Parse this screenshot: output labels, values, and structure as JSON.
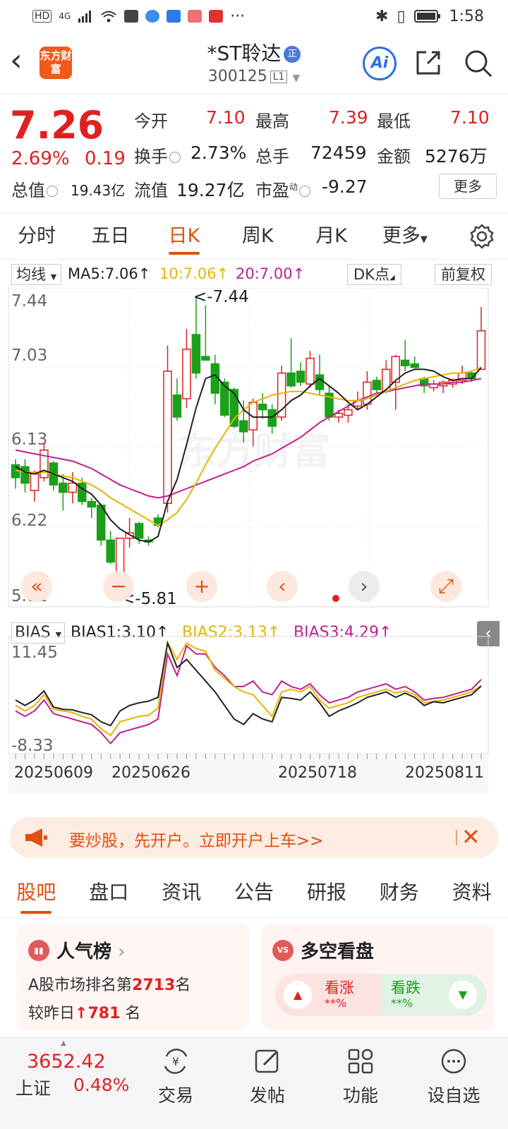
{
  "status_bar": {
    "time": "1:58",
    "network": "4G"
  },
  "header": {
    "stock_name": "*ST聆达",
    "stock_code": "300125",
    "level": "L1",
    "brand_logo_text": "东方财富",
    "ai_label": "Ai"
  },
  "quote": {
    "price": "7.26",
    "change_pct": "2.69%",
    "change": "0.19",
    "fields": [
      {
        "label": "今开",
        "value": "7.10"
      },
      {
        "label": "最高",
        "value": "7.39"
      },
      {
        "label": "最低",
        "value": "7.10"
      },
      {
        "label": "换手",
        "value": "2.73%"
      },
      {
        "label": "总手",
        "value": "72459"
      },
      {
        "label": "金额",
        "value": "5276万"
      },
      {
        "label": "总值",
        "value": "19.43亿"
      },
      {
        "label": "流值",
        "value": "19.27亿"
      },
      {
        "label": "市盈",
        "value": "-9.27"
      }
    ],
    "pe_superscript": "动",
    "more_label": "更多"
  },
  "period_tabs": [
    "分时",
    "五日",
    "日K",
    "周K",
    "月K",
    "更多"
  ],
  "active_period": "日K",
  "ma_bar": {
    "selector": "均线",
    "ma5": "MA5:7.06",
    "ma10": "10:7.06",
    "ma20": "20:7.00",
    "dk_label": "DK点",
    "adjust_label": "前复权"
  },
  "colors": {
    "up": "#e02020",
    "down": "#1aa01a",
    "accent": "#e05010",
    "ma5": "#222222",
    "ma10": "#e8b400",
    "ma20": "#c0208e"
  },
  "chart_data": [
    {
      "type": "candlestick",
      "y_ticks": [
        "7.44",
        "7.03",
        "6.13",
        "6.22",
        "5.81"
      ],
      "ylim": [
        5.81,
        7.44
      ],
      "annotations": [
        "<-7.44",
        "<-5.81"
      ],
      "x_ticks": [
        "20250609",
        "20250626",
        "20250718",
        "20250811"
      ],
      "candles": [
        {
          "o": 6.53,
          "h": 6.56,
          "l": 6.4,
          "c": 6.46
        },
        {
          "o": 6.52,
          "h": 6.56,
          "l": 6.38,
          "c": 6.43
        },
        {
          "o": 6.39,
          "h": 6.5,
          "l": 6.33,
          "c": 6.48
        },
        {
          "o": 6.46,
          "h": 6.65,
          "l": 6.44,
          "c": 6.61
        },
        {
          "o": 6.54,
          "h": 6.55,
          "l": 6.39,
          "c": 6.42
        },
        {
          "o": 6.43,
          "h": 6.48,
          "l": 6.28,
          "c": 6.38
        },
        {
          "o": 6.38,
          "h": 6.49,
          "l": 6.32,
          "c": 6.43
        },
        {
          "o": 6.43,
          "h": 6.46,
          "l": 6.31,
          "c": 6.33
        },
        {
          "o": 6.33,
          "h": 6.35,
          "l": 6.24,
          "c": 6.3
        },
        {
          "o": 6.31,
          "h": 6.32,
          "l": 6.09,
          "c": 6.12
        },
        {
          "o": 6.12,
          "h": 6.17,
          "l": 5.99,
          "c": 6.0
        },
        {
          "o": 5.88,
          "h": 6.13,
          "l": 5.81,
          "c": 6.13
        },
        {
          "o": 6.13,
          "h": 6.24,
          "l": 6.08,
          "c": 6.16
        },
        {
          "o": 6.21,
          "h": 6.22,
          "l": 6.1,
          "c": 6.13
        },
        {
          "o": 6.12,
          "h": 6.14,
          "l": 6.09,
          "c": 6.11
        },
        {
          "o": 6.24,
          "h": 6.26,
          "l": 6.19,
          "c": 6.2
        },
        {
          "o": 6.32,
          "h": 7.18,
          "l": 6.27,
          "c": 7.04
        },
        {
          "o": 6.91,
          "h": 7.0,
          "l": 6.77,
          "c": 6.79
        },
        {
          "o": 6.89,
          "h": 7.27,
          "l": 6.84,
          "c": 7.16
        },
        {
          "o": 7.24,
          "h": 7.44,
          "l": 7.0,
          "c": 7.03
        },
        {
          "o": 7.12,
          "h": 7.4,
          "l": 7.1,
          "c": 7.1
        },
        {
          "o": 7.08,
          "h": 7.13,
          "l": 6.86,
          "c": 6.92
        },
        {
          "o": 6.98,
          "h": 7.0,
          "l": 6.79,
          "c": 6.8
        },
        {
          "o": 6.94,
          "h": 6.95,
          "l": 6.73,
          "c": 6.74
        },
        {
          "o": 6.77,
          "h": 6.88,
          "l": 6.65,
          "c": 6.71
        },
        {
          "o": 6.72,
          "h": 6.89,
          "l": 6.63,
          "c": 6.87
        },
        {
          "o": 6.86,
          "h": 6.92,
          "l": 6.78,
          "c": 6.83
        },
        {
          "o": 6.83,
          "h": 6.86,
          "l": 6.7,
          "c": 6.74
        },
        {
          "o": 6.79,
          "h": 7.07,
          "l": 6.77,
          "c": 7.03
        },
        {
          "o": 7.03,
          "h": 7.22,
          "l": 6.95,
          "c": 6.96
        },
        {
          "o": 7.04,
          "h": 7.09,
          "l": 6.96,
          "c": 6.98
        },
        {
          "o": 6.97,
          "h": 7.15,
          "l": 6.95,
          "c": 7.11
        },
        {
          "o": 7.02,
          "h": 7.13,
          "l": 6.91,
          "c": 6.94
        },
        {
          "o": 6.92,
          "h": 6.96,
          "l": 6.77,
          "c": 6.79
        },
        {
          "o": 6.79,
          "h": 6.83,
          "l": 6.76,
          "c": 6.81
        },
        {
          "o": 6.8,
          "h": 6.86,
          "l": 6.76,
          "c": 6.83
        },
        {
          "o": 6.85,
          "h": 6.93,
          "l": 6.83,
          "c": 6.88
        },
        {
          "o": 6.86,
          "h": 7.04,
          "l": 6.83,
          "c": 6.98
        },
        {
          "o": 6.99,
          "h": 7.01,
          "l": 6.92,
          "c": 6.94
        },
        {
          "o": 6.93,
          "h": 7.1,
          "l": 6.92,
          "c": 7.05
        },
        {
          "o": 6.98,
          "h": 7.13,
          "l": 6.83,
          "c": 7.12
        },
        {
          "o": 7.1,
          "h": 7.21,
          "l": 7.04,
          "c": 7.07
        },
        {
          "o": 7.08,
          "h": 7.12,
          "l": 7.06,
          "c": 7.06
        },
        {
          "o": 7.0,
          "h": 7.01,
          "l": 6.92,
          "c": 6.96
        },
        {
          "o": 6.95,
          "h": 6.99,
          "l": 6.93,
          "c": 6.97
        },
        {
          "o": 6.96,
          "h": 6.99,
          "l": 6.92,
          "c": 6.98
        },
        {
          "o": 6.97,
          "h": 7.0,
          "l": 6.95,
          "c": 6.99
        },
        {
          "o": 6.99,
          "h": 7.07,
          "l": 6.97,
          "c": 7.03
        },
        {
          "o": 7.03,
          "h": 7.04,
          "l": 6.98,
          "c": 7.0
        },
        {
          "o": 7.05,
          "h": 7.39,
          "l": 7.1,
          "c": 7.26
        }
      ],
      "ma5": [
        6.52,
        6.49,
        6.48,
        6.5,
        6.48,
        6.46,
        6.44,
        6.4,
        6.37,
        6.31,
        6.23,
        6.18,
        6.15,
        6.12,
        6.11,
        6.14,
        6.33,
        6.45,
        6.64,
        6.84,
        7.0,
        7.02,
        6.96,
        6.92,
        6.83,
        6.79,
        6.79,
        6.79,
        6.83,
        6.88,
        6.91,
        6.96,
        7.0,
        6.96,
        6.92,
        6.87,
        6.83,
        6.86,
        6.9,
        6.94,
        6.99,
        7.03,
        7.05,
        7.05,
        7.04,
        7.01,
        6.99,
        7.0,
        7.0,
        7.06
      ],
      "ma10": [
        6.5,
        6.49,
        6.49,
        6.49,
        6.48,
        6.47,
        6.46,
        6.44,
        6.42,
        6.39,
        6.35,
        6.32,
        6.29,
        6.26,
        6.23,
        6.2,
        6.23,
        6.27,
        6.34,
        6.43,
        6.53,
        6.62,
        6.7,
        6.78,
        6.83,
        6.87,
        6.89,
        6.91,
        6.92,
        6.93,
        6.93,
        6.92,
        6.91,
        6.9,
        6.89,
        6.88,
        6.88,
        6.89,
        6.91,
        6.93,
        6.95,
        6.97,
        6.99,
        7.0,
        7.01,
        7.02,
        7.03,
        7.03,
        7.04,
        7.06
      ],
      "ma20": [
        6.61,
        6.6,
        6.59,
        6.58,
        6.57,
        6.56,
        6.55,
        6.53,
        6.51,
        6.48,
        6.45,
        6.42,
        6.4,
        6.38,
        6.36,
        6.35,
        6.36,
        6.38,
        6.4,
        6.42,
        6.44,
        6.46,
        6.48,
        6.5,
        6.52,
        6.55,
        6.57,
        6.59,
        6.62,
        6.65,
        6.68,
        6.72,
        6.76,
        6.79,
        6.82,
        6.85,
        6.88,
        6.9,
        6.92,
        6.93,
        6.94,
        6.95,
        6.96,
        6.97,
        6.97,
        6.97,
        6.98,
        6.98,
        6.99,
        7.0
      ]
    },
    {
      "type": "line",
      "indicator": "BIAS",
      "y_ticks": [
        "11.45",
        "-8.33"
      ],
      "ylim": [
        -8.33,
        11.45
      ],
      "legend": [
        "BIAS1:3.10",
        "BIAS2:3.13",
        "BIAS3:4.29"
      ],
      "series": [
        {
          "name": "BIAS1",
          "values": [
            0.5,
            -0.5,
            0.5,
            2.2,
            -0.8,
            -1.2,
            -1.3,
            -1.8,
            -2.2,
            -3.5,
            -4.2,
            -1.5,
            -0.5,
            0.0,
            0.3,
            1.0,
            11.0,
            6.5,
            8.0,
            6.0,
            4.0,
            2.0,
            -0.5,
            -3.0,
            -4.0,
            -2.0,
            -3.0,
            -3.5,
            1.0,
            0.8,
            0.5,
            2.0,
            0.0,
            -2.5,
            -1.5,
            -0.8,
            0.0,
            1.0,
            1.5,
            2.0,
            1.0,
            1.8,
            1.0,
            -0.5,
            0.2,
            0.0,
            0.5,
            1.0,
            1.5,
            3.1
          ]
        },
        {
          "name": "BIAS2",
          "values": [
            -0.5,
            -1.5,
            -0.5,
            1.5,
            -1.2,
            -1.5,
            -1.8,
            -2.5,
            -3.0,
            -4.8,
            -6.0,
            -3.5,
            -3.0,
            -2.5,
            -2.3,
            -1.0,
            11.2,
            8.0,
            11.0,
            10.0,
            9.5,
            6.0,
            4.5,
            3.0,
            2.0,
            1.5,
            -0.5,
            -2.5,
            2.0,
            2.5,
            2.0,
            3.0,
            0.5,
            -1.0,
            -0.5,
            0.0,
            1.0,
            1.5,
            2.0,
            2.5,
            1.8,
            2.2,
            1.5,
            0.0,
            0.3,
            0.5,
            1.0,
            1.5,
            2.0,
            3.13
          ]
        },
        {
          "name": "BIAS3",
          "values": [
            -1.5,
            -2.5,
            -1.5,
            0.5,
            -2.0,
            -2.5,
            -3.0,
            -3.5,
            -4.0,
            -5.5,
            -7.5,
            -5.5,
            -5.0,
            -4.5,
            -4.0,
            -3.0,
            9.0,
            5.0,
            10.5,
            9.0,
            9.0,
            6.5,
            5.0,
            3.0,
            3.0,
            4.0,
            2.0,
            1.5,
            4.0,
            3.0,
            2.5,
            3.5,
            1.5,
            0.0,
            0.5,
            1.0,
            2.0,
            2.5,
            3.0,
            3.5,
            2.5,
            3.0,
            2.0,
            0.5,
            0.8,
            1.0,
            1.5,
            2.0,
            2.5,
            4.29
          ]
        }
      ]
    }
  ],
  "bias_bar": {
    "selector": "BIAS",
    "bias1": "BIAS1:3.10",
    "bias2": "BIAS2:3.13",
    "bias3": "BIAS3:4.29"
  },
  "watermark": "东方财富",
  "ad": {
    "text": "要炒股，先开户。立即开户上车>>"
  },
  "section_tabs": [
    "股吧",
    "盘口",
    "资讯",
    "公告",
    "研报",
    "财务",
    "资料"
  ],
  "active_section": "股吧",
  "popularity_card": {
    "title": "人气榜",
    "line1_prefix": "A股市场排名第",
    "rank": "2713",
    "line1_suffix": "名",
    "line2_prefix": "较昨日",
    "delta": "781",
    "line2_suffix": "名"
  },
  "sentiment_card": {
    "icon": "VS",
    "title": "多空看盘",
    "up_label": "看涨",
    "up_pct": "**%",
    "down_label": "看跌",
    "down_pct": "**%"
  },
  "bottom_bar": {
    "index_value": "3652.42",
    "index_name": "上证",
    "index_pct": "0.48%",
    "items": [
      "交易",
      "发帖",
      "功能",
      "设自选"
    ]
  }
}
